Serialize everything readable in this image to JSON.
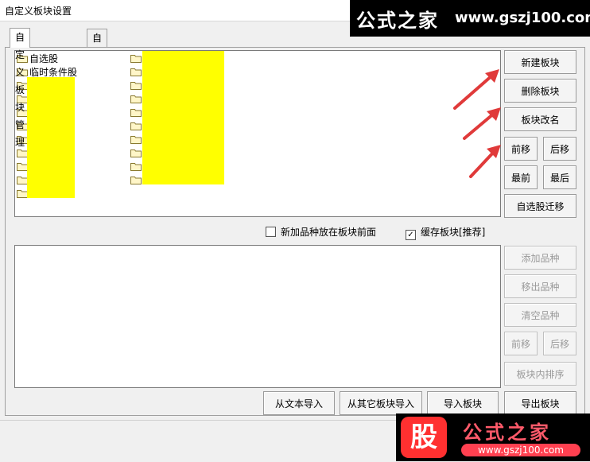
{
  "window": {
    "title": "自定义板块设置"
  },
  "tabs": [
    {
      "label": "自定义板块管理",
      "active": true
    },
    {
      "label": "自定义板块颜色",
      "active": false
    }
  ],
  "blocks_list": {
    "items_visible": [
      "自选股",
      "临时条件股"
    ],
    "highlight_color": "#ffff00"
  },
  "right_buttons": {
    "new_block": "新建板块",
    "delete_block": "删除板块",
    "rename_block": "板块改名",
    "move_up": "前移",
    "move_down": "后移",
    "move_first": "最前",
    "move_last": "最后",
    "migrate": "自选股迁移"
  },
  "checkboxes": {
    "new_items_front": {
      "label": "新加品种放在板块前面",
      "checked": false
    },
    "cache_blocks": {
      "label": "缓存板块[推荐]",
      "checked": true
    }
  },
  "item_buttons": {
    "add_item": "添加品种",
    "remove_item": "移出品种",
    "clear_items": "清空品种",
    "move_up": "前移",
    "move_down": "后移",
    "sort_in_block": "板块内排序"
  },
  "bottom_buttons": {
    "import_text": "从文本导入",
    "import_other": "从其它板块导入",
    "import_block": "导入板块",
    "export_block": "导出板块"
  },
  "watermark_top": {
    "brand": "公式之家",
    "url": "www.gszj100.com"
  },
  "watermark_bottom": {
    "logo": "股",
    "brand": "公式之家",
    "url": "www.gszj100.com"
  },
  "colors": {
    "arrow": "#e03a3a",
    "watermark_red": "#ff4050"
  }
}
